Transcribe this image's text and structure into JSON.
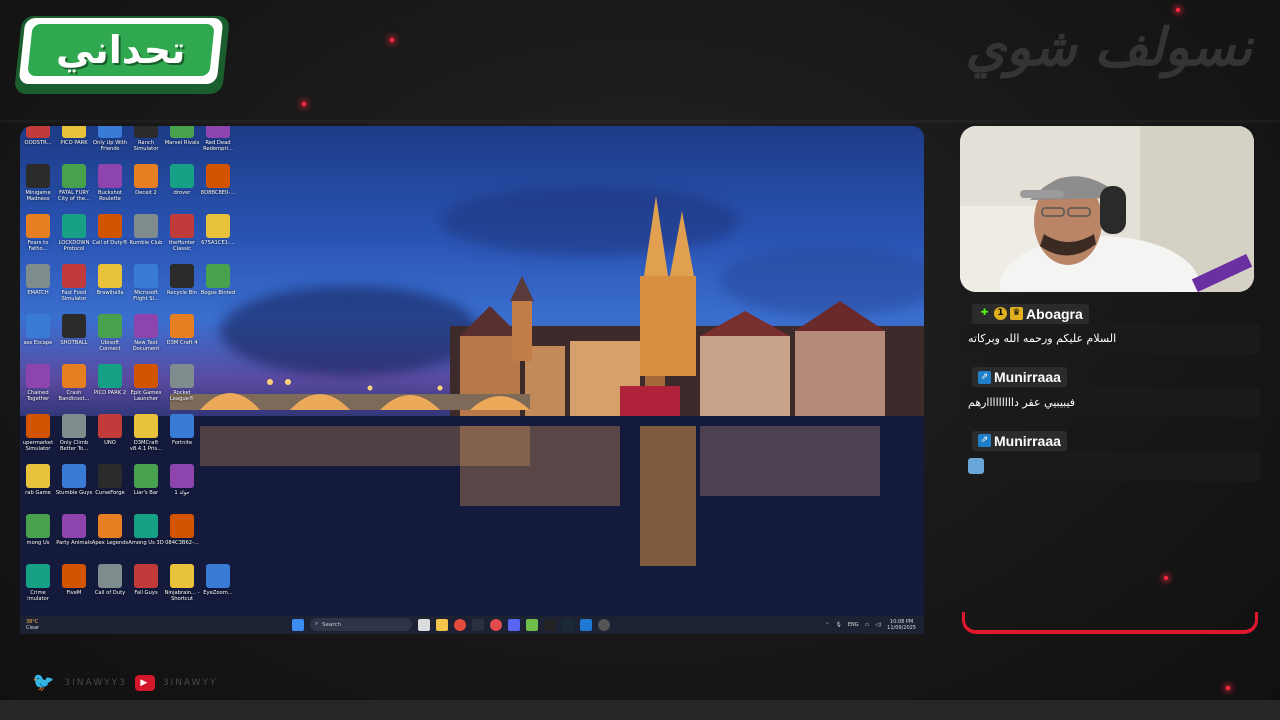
{
  "channel": {
    "logo_text": "تحداني",
    "watermark": "نسولف شوي",
    "handle_twitter": "3INAWYY3",
    "handle_youtube": "3INAWYY"
  },
  "desktop": {
    "icons": [
      [
        "OODSTR...",
        "PICO PARK",
        "Only Up With Friends",
        "Ranch Simulator",
        "Marvel Rivals",
        "Red Dead Redempti..."
      ],
      [
        "Minigame Madness",
        "FATAL FURY City of the...",
        "Buckshot Roulette",
        "Deceit 2",
        "drover",
        "8D8BC8E0-..."
      ],
      [
        "Fears to Fatho...",
        "LOCKDOWN Protocol",
        "Call of Duty®",
        "Rumble Club",
        "theHunter Classic",
        "675A1CE1-..."
      ],
      [
        "EMATCH",
        "Fast Food Simulator",
        "Brawlhalla",
        "Microsoft Flight Si...",
        "Recycle Bin",
        "Bogos Binted"
      ],
      [
        "ass Escape",
        "SHOTBALL",
        "Ubisoft Connect",
        "New Text Document",
        "D3M Craft 4",
        ""
      ],
      [
        "Chained Together",
        "Crash Bandicoot...",
        "PICO PARK 2",
        "Epic Games Launcher",
        "Rocket League®",
        ""
      ],
      [
        "upermarket Simulator",
        "Only Climb Better To...",
        "UNO",
        "D3MCraft v8.4.1 Pris...",
        "Fortnite",
        ""
      ],
      [
        "rab Game",
        "Stumble Guys",
        "CurseForge",
        "Liar's Bar",
        "جولة 1",
        ""
      ],
      [
        "mong Us",
        "Party Animals",
        "Apex Legends",
        "Among Us 3D",
        "084C3B62-...",
        ""
      ],
      [
        "Crime imulator",
        "FiveM",
        "Call of Duty",
        "Fall Guys",
        "Ninjabrain... - Shortcut",
        "EyeZoom..."
      ]
    ],
    "taskbar": {
      "weather_temp": "38°C",
      "weather_desc": "Clear",
      "search_placeholder": "Search",
      "lang": "ENG",
      "time": "10:08 PM",
      "date": "11/09/2025"
    }
  },
  "chat": {
    "messages": [
      {
        "user": "Aboagra",
        "text": "السلام عليكم ورحمه الله وبركاته"
      },
      {
        "user": "Munirraaa",
        "text": "فيبيبيي عقر دااااااااارهم"
      },
      {
        "user": "Munirraaa",
        "text": ""
      }
    ]
  },
  "colors": {
    "accent": "#e0182d",
    "logo_green": "#2fa84f",
    "kick_green": "#53fc18"
  }
}
